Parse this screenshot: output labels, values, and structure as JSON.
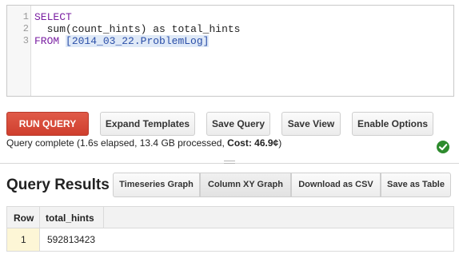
{
  "editor": {
    "line_numbers": [
      "1",
      "2",
      "3"
    ],
    "line1": {
      "keyword": "SELECT"
    },
    "line2": {
      "indent": "  ",
      "func": "sum",
      "open": "(",
      "arg": "count_hints",
      "close_as": ") as total_hints"
    },
    "line3": {
      "keyword": "FROM",
      "space": " ",
      "table": "[2014_03_22.ProblemLog]"
    }
  },
  "toolbar": {
    "run_label": "RUN QUERY",
    "expand_label": "Expand Templates",
    "save_query_label": "Save Query",
    "save_view_label": "Save View",
    "enable_options_label": "Enable Options"
  },
  "status": {
    "prefix": "Query complete (1.6s elapsed, 13.4 GB processed, ",
    "cost_label": "Cost: 46.9¢",
    "suffix": ")"
  },
  "results": {
    "title": "Query Results",
    "buttons": [
      "Timeseries Graph",
      "Column XY Graph",
      "Download as CSV",
      "Save as Table"
    ],
    "columns": [
      "Row",
      "total_hints"
    ],
    "rows": [
      [
        "1",
        "592813423"
      ]
    ]
  },
  "colors": {
    "run_button": "#d9473a",
    "success": "#2e8b2e",
    "row_highlight": "#fdf6d6"
  },
  "icons": {
    "status": "check-circle-icon"
  }
}
